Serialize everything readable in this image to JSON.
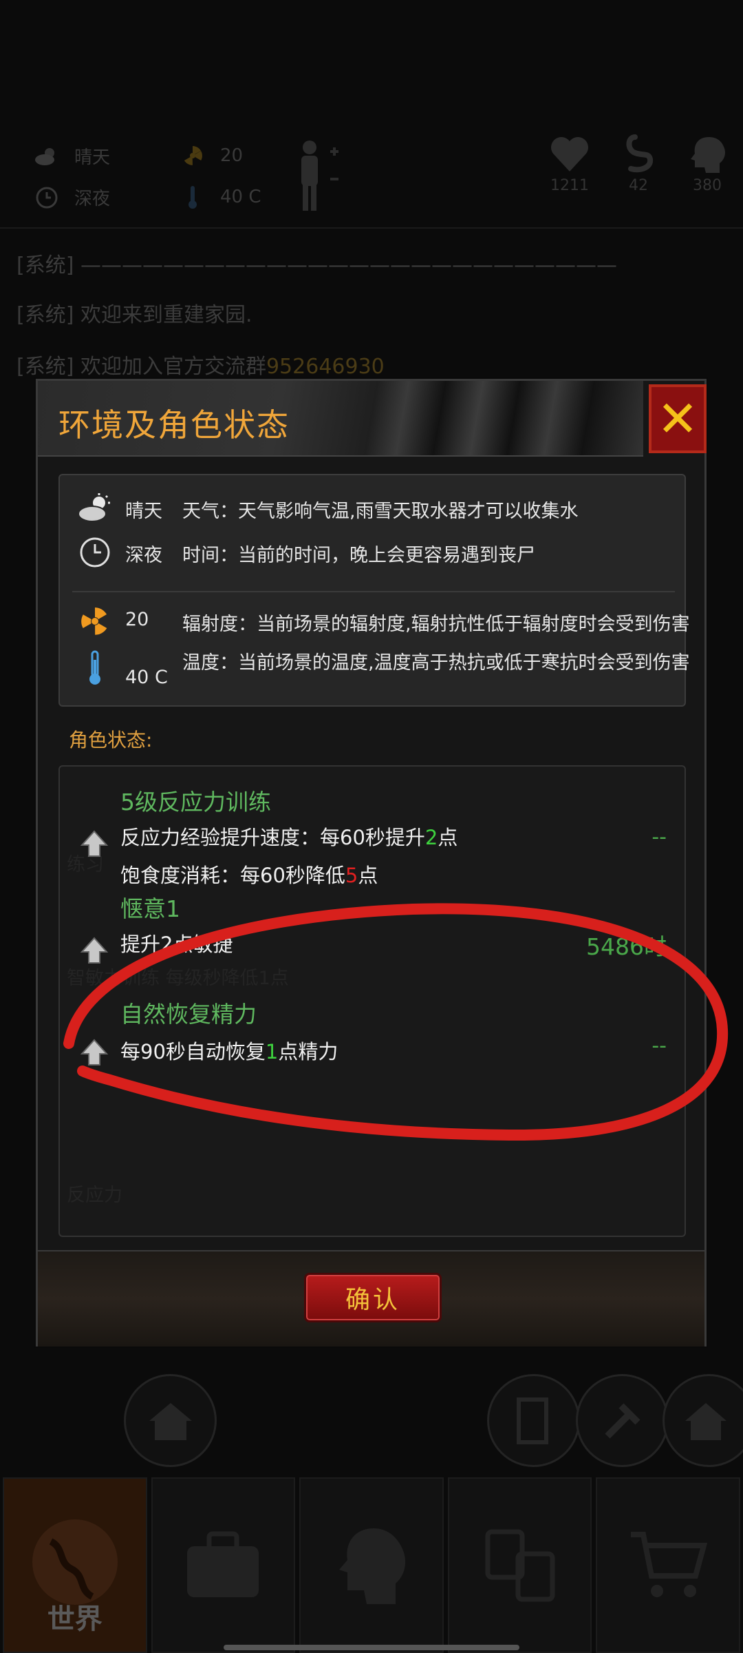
{
  "background": {
    "weather": {
      "label": "晴天",
      "icon": "cloud-sun-icon"
    },
    "time": {
      "label": "深夜",
      "icon": "clock-icon"
    },
    "radiation": {
      "value": "20",
      "icon": "radiation-icon"
    },
    "temperature": {
      "value": "40 C",
      "icon": "thermometer-icon"
    },
    "vitals": [
      {
        "name": "health",
        "icon": "heart-icon",
        "value": "1211"
      },
      {
        "name": "hunger",
        "icon": "stomach-icon",
        "value": "42"
      },
      {
        "name": "mind",
        "icon": "head-icon",
        "value": "380"
      }
    ],
    "log": [
      {
        "tag": "[系统]",
        "text": "——————————————————————————",
        "num": ""
      },
      {
        "tag": "[系统]",
        "text": "欢迎来到重建家园.",
        "num": ""
      },
      {
        "tag": "[系统]",
        "text": "欢迎加入官方交流群",
        "num": "952646930"
      }
    ],
    "tabs": [
      {
        "label": "世界",
        "icon": "globe-icon"
      },
      {
        "label": "",
        "icon": "suitcase-icon"
      },
      {
        "label": "",
        "icon": "head-gear-icon"
      },
      {
        "label": "",
        "icon": "exchange-icon"
      },
      {
        "label": "",
        "icon": "cart-icon"
      }
    ]
  },
  "modal": {
    "title": "环境及角色状态",
    "close_label": "✕",
    "env": [
      {
        "icon": "cloud-sun-icon",
        "value": "晴天",
        "desc": "天气：天气影响气温,雨雪天取水器才可以收集水"
      },
      {
        "icon": "clock-icon",
        "value": "深夜",
        "desc": "时间：当前的时间，晚上会更容易遇到丧尸"
      },
      {
        "icon": "radiation-icon",
        "value": "20",
        "desc": "辐射度：当前场景的辐射度,辐射抗性低于辐射度时会受到伤害"
      },
      {
        "icon": "thermometer-icon",
        "value": "40 C",
        "desc": "温度：当前场景的温度,温度高于热抗或低于寒抗时会受到伤害"
      }
    ],
    "status_label": "角色状态:",
    "skills": [
      {
        "name": "5级反应力训练",
        "lines": [
          {
            "pre": "反应力经验提升速度：每60秒提升",
            "hl": "2",
            "post": "点",
            "hl_color": "green"
          },
          {
            "pre": "饱食度消耗：每60秒降低",
            "hl": "5",
            "post": "点",
            "hl_color": "red"
          }
        ],
        "right": "--"
      },
      {
        "name": "惬意1",
        "lines": [
          {
            "pre": "提升2点敏捷",
            "hl": "",
            "post": "",
            "hl_color": "green"
          }
        ],
        "right": "5486时"
      },
      {
        "name": "自然恢复精力",
        "lines": [
          {
            "pre": "每90秒自动恢复",
            "hl": "1",
            "post": "点精力",
            "hl_color": "green"
          }
        ],
        "right": "--"
      }
    ],
    "confirm_label": "确认"
  },
  "colors": {
    "title_orange": "#f0a63a",
    "skill_green": "#5fb85f",
    "highlight_green": "#3ed13e",
    "highlight_red": "#e02020",
    "annotation_red": "#d8201c"
  }
}
